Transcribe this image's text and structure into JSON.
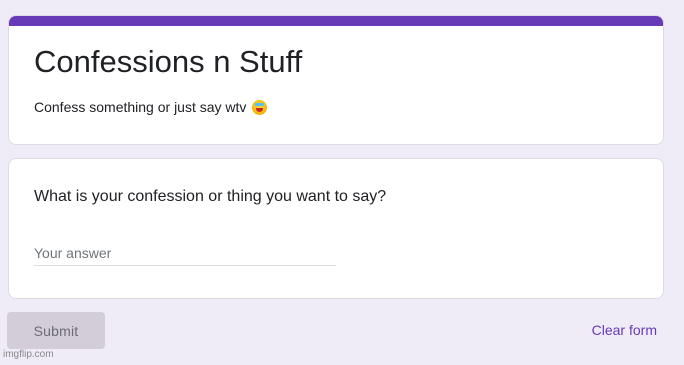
{
  "form": {
    "title": "Confessions n Stuff",
    "description": "Confess something or just say wtv",
    "description_emoji": "laughing-face-emoji",
    "accent_color": "#673ab7"
  },
  "question": {
    "text": "What is your confession or thing you want to say?",
    "answer_placeholder": "Your answer",
    "answer_value": ""
  },
  "actions": {
    "submit_label": "Submit",
    "clear_label": "Clear form"
  },
  "watermark": {
    "text": "imgflip.com"
  }
}
